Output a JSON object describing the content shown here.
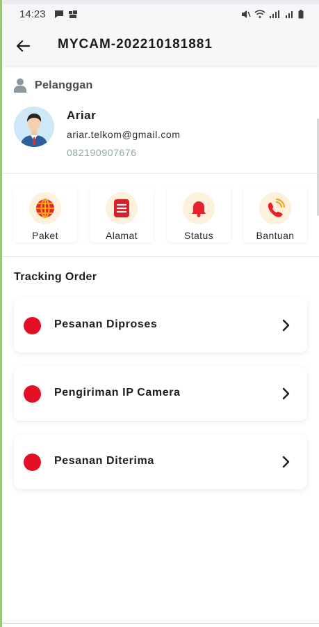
{
  "status_bar": {
    "time": "14:23"
  },
  "header": {
    "title": "MYCAM-202210181881"
  },
  "customer": {
    "section_label": "Pelanggan",
    "name": "Ariar",
    "email": "ariar.telkom@gmail.com",
    "phone": "082190907676"
  },
  "menu": [
    {
      "label": "Paket",
      "icon": "globe-icon"
    },
    {
      "label": "Alamat",
      "icon": "document-icon"
    },
    {
      "label": "Status",
      "icon": "bell-icon"
    },
    {
      "label": "Bantuan",
      "icon": "phone-call-icon"
    }
  ],
  "tracking": {
    "title": "Tracking Order",
    "steps": [
      {
        "label": "Pesanan Diproses",
        "status_color": "#e20f25"
      },
      {
        "label": "Pengiriman IP Camera",
        "status_color": "#e20f25"
      },
      {
        "label": "Pesanan Diterima",
        "status_color": "#e20f25"
      }
    ]
  },
  "colors": {
    "accent_red": "#e20f25",
    "icon_bg": "#fdf1dc",
    "phone_text": "#8fa6a6"
  }
}
